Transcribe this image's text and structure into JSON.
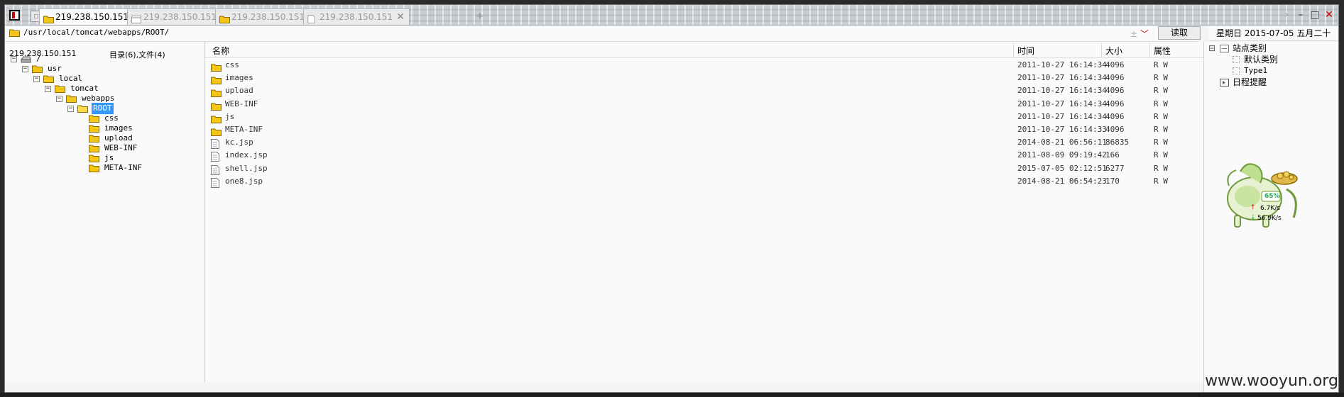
{
  "tabs": [
    {
      "label": "219.238.150.151",
      "active": true,
      "icon": "folder-icon"
    },
    {
      "label": "219.238.150.151",
      "active": false,
      "icon": "terminal-icon"
    },
    {
      "label": "219.238.150.151",
      "active": false,
      "icon": "folder-icon"
    },
    {
      "label": "219.238.150.151",
      "active": false,
      "icon": "document-icon"
    }
  ],
  "tab_close": "✕",
  "tab_add": "+",
  "window_buttons": {
    "next": "›",
    "minimize": "–",
    "maximize": "□",
    "close": "✕"
  },
  "address": {
    "path": "/usr/local/tomcat/webapps/ROOT/",
    "tools": "± ",
    "chevron": "﹀",
    "read_button": "读取"
  },
  "date": "星期日  2015-07-05  五月二十",
  "left_pane": {
    "host": "219.238.150.151",
    "counts": "目录(6),文件(4)",
    "tree": [
      {
        "label": "/",
        "depth": 0,
        "expander": "⊟",
        "icon": "drive-icon",
        "selected": false
      },
      {
        "label": "usr",
        "depth": 1,
        "expander": "⊟",
        "icon": "folder-icon",
        "selected": false
      },
      {
        "label": "local",
        "depth": 2,
        "expander": "⊟",
        "icon": "folder-icon",
        "selected": false
      },
      {
        "label": "tomcat",
        "depth": 3,
        "expander": "⊟",
        "icon": "folder-icon",
        "selected": false
      },
      {
        "label": "webapps",
        "depth": 4,
        "expander": "⊟",
        "icon": "folder-icon",
        "selected": false
      },
      {
        "label": "ROOT",
        "depth": 5,
        "expander": "⊟",
        "icon": "folder-open-icon",
        "selected": true
      },
      {
        "label": "css",
        "depth": 6,
        "expander": "",
        "icon": "folder-icon",
        "selected": false
      },
      {
        "label": "images",
        "depth": 6,
        "expander": "",
        "icon": "folder-icon",
        "selected": false
      },
      {
        "label": "upload",
        "depth": 6,
        "expander": "",
        "icon": "folder-icon",
        "selected": false
      },
      {
        "label": "WEB-INF",
        "depth": 6,
        "expander": "",
        "icon": "folder-icon",
        "selected": false
      },
      {
        "label": "js",
        "depth": 6,
        "expander": "",
        "icon": "folder-icon",
        "selected": false
      },
      {
        "label": "META-INF",
        "depth": 6,
        "expander": "",
        "icon": "folder-icon",
        "selected": false
      }
    ]
  },
  "file_list": {
    "columns": {
      "name": "名称",
      "time": "时间",
      "size": "大小",
      "attr": "属性"
    },
    "rows": [
      {
        "name": "css",
        "time": "2011-10-27 16:14:34",
        "size": "4096",
        "attr": "R W",
        "type": "folder"
      },
      {
        "name": "images",
        "time": "2011-10-27 16:14:34",
        "size": "4096",
        "attr": "R W",
        "type": "folder"
      },
      {
        "name": "upload",
        "time": "2011-10-27 16:14:34",
        "size": "4096",
        "attr": "R W",
        "type": "folder"
      },
      {
        "name": "WEB-INF",
        "time": "2011-10-27 16:14:34",
        "size": "4096",
        "attr": "R W",
        "type": "folder"
      },
      {
        "name": "js",
        "time": "2011-10-27 16:14:34",
        "size": "4096",
        "attr": "R W",
        "type": "folder"
      },
      {
        "name": "META-INF",
        "time": "2011-10-27 16:14:33",
        "size": "4096",
        "attr": "R W",
        "type": "folder"
      },
      {
        "name": "kc.jsp",
        "time": "2014-08-21 06:56:11",
        "size": "86835",
        "attr": "R W",
        "type": "file"
      },
      {
        "name": "index.jsp",
        "time": "2011-08-09 09:19:42",
        "size": "166",
        "attr": "R W",
        "type": "file"
      },
      {
        "name": "shell.jsp",
        "time": "2015-07-05 02:12:51",
        "size": "6277",
        "attr": "R W",
        "type": "file"
      },
      {
        "name": "one8.jsp",
        "time": "2014-08-21 06:54:23",
        "size": "170",
        "attr": "R W",
        "type": "file"
      }
    ]
  },
  "right_pane": {
    "site_category": "站点类别",
    "default_category": "默认类别",
    "type1": "Type1",
    "schedule": "日程提醒",
    "expander": "⊟"
  },
  "net_monitor": {
    "percent": "65%",
    "upload": "6.7K/s",
    "download": "56.9K/s",
    "up_arrow": "↑",
    "down_arrow": "↓"
  },
  "watermark": "www.wooyun.org",
  "colors": {
    "selection": "#3399ff",
    "folder": "#f5c518",
    "close_red": "#cc0000"
  }
}
